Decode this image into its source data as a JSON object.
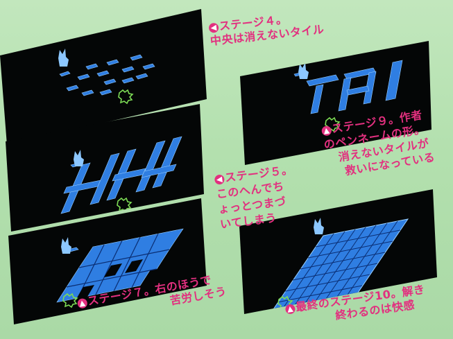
{
  "screenshots": [
    {
      "name": "stage-4-screen"
    },
    {
      "name": "stage-9-screen"
    },
    {
      "name": "stage-5-screen"
    },
    {
      "name": "stage-7-screen"
    },
    {
      "name": "stage-10-screen"
    }
  ],
  "captions": {
    "stage4": {
      "arrow": "left-arrow-icon",
      "lines": [
        "ステージ４。",
        "中央は消えないタイル"
      ]
    },
    "stage9": {
      "arrow": "up-arrow-icon",
      "lines": [
        "ステージ９。作者",
        "のペンネームの形。",
        "消えないタイルが",
        "救いになっている"
      ]
    },
    "stage5": {
      "arrow": "left-arrow-icon",
      "lines": [
        "ステージ５。",
        "このへんでち",
        "ょっとつまづ",
        "いてしまう"
      ]
    },
    "stage7": {
      "arrow": "up-arrow-icon",
      "lines": [
        "ステージ７。右のほうで",
        "苦労しそう"
      ]
    },
    "stage10": {
      "arrow": "up-arrow-icon",
      "lines": [
        "最終のステージ10。解き",
        "終わるのは快感"
      ]
    }
  },
  "colors": {
    "caption": "#e2307f",
    "tile_face": "#2f7ee2",
    "tile_side": "#1544a0",
    "tile_outline": "#9ad0ff",
    "player": "#8cc7ff",
    "goal": "#7ddc55",
    "screen_bg": "#040606",
    "page_bg": "#b5e2b0"
  }
}
